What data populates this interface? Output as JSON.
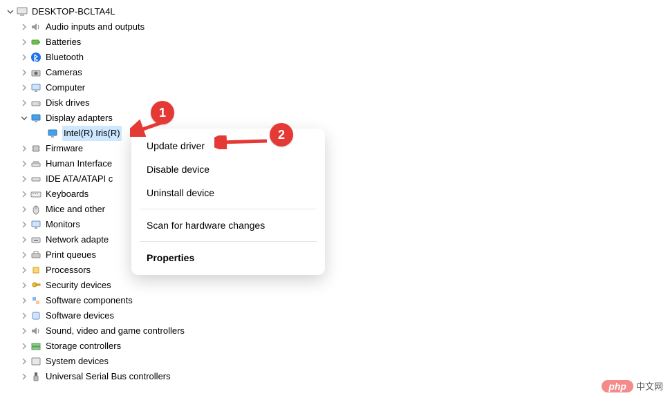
{
  "root": {
    "name": "DESKTOP-BCLTA4L"
  },
  "categories": [
    {
      "label": "Audio inputs and outputs",
      "expanded": false
    },
    {
      "label": "Batteries",
      "expanded": false
    },
    {
      "label": "Bluetooth",
      "expanded": false
    },
    {
      "label": "Cameras",
      "expanded": false
    },
    {
      "label": "Computer",
      "expanded": false
    },
    {
      "label": "Disk drives",
      "expanded": false
    },
    {
      "label": "Display adapters",
      "expanded": true,
      "children": [
        {
          "label": "Intel(R) Iris(R)",
          "selected": true
        }
      ]
    },
    {
      "label": "Firmware",
      "expanded": false
    },
    {
      "label": "Human Interface",
      "expanded": false
    },
    {
      "label": "IDE ATA/ATAPI c",
      "expanded": false
    },
    {
      "label": "Keyboards",
      "expanded": false
    },
    {
      "label": "Mice and other",
      "expanded": false
    },
    {
      "label": "Monitors",
      "expanded": false
    },
    {
      "label": "Network adapte",
      "expanded": false
    },
    {
      "label": "Print queues",
      "expanded": false
    },
    {
      "label": "Processors",
      "expanded": false
    },
    {
      "label": "Security devices",
      "expanded": false
    },
    {
      "label": "Software components",
      "expanded": false
    },
    {
      "label": "Software devices",
      "expanded": false
    },
    {
      "label": "Sound, video and game controllers",
      "expanded": false
    },
    {
      "label": "Storage controllers",
      "expanded": false
    },
    {
      "label": "System devices",
      "expanded": false
    },
    {
      "label": "Universal Serial Bus controllers",
      "expanded": false
    }
  ],
  "context_menu": {
    "items": [
      "Update driver",
      "Disable device",
      "Uninstall device"
    ],
    "scan": "Scan for hardware changes",
    "properties": "Properties"
  },
  "annotations": {
    "badge1": "1",
    "badge2": "2"
  },
  "watermark": {
    "pill": "php",
    "text": "中文网"
  }
}
